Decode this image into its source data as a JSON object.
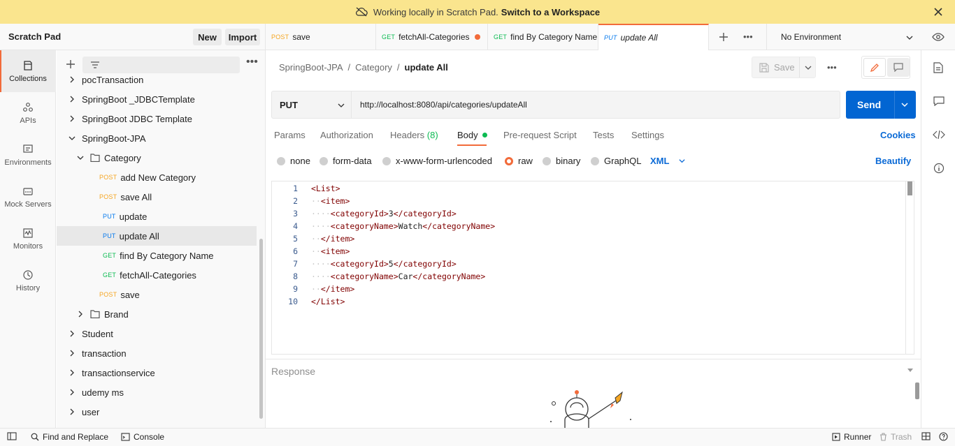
{
  "banner": {
    "text": "Working locally in Scratch Pad.",
    "link": "Switch to a Workspace"
  },
  "workspace": {
    "title": "Scratch Pad",
    "new_label": "New",
    "import_label": "Import"
  },
  "rail": {
    "items": [
      {
        "label": "Collections",
        "icon": "collections-icon"
      },
      {
        "label": "APIs",
        "icon": "apis-icon"
      },
      {
        "label": "Environments",
        "icon": "environments-icon"
      },
      {
        "label": "Mock Servers",
        "icon": "mock-servers-icon"
      },
      {
        "label": "Monitors",
        "icon": "monitors-icon"
      },
      {
        "label": "History",
        "icon": "history-icon"
      }
    ]
  },
  "tree": {
    "top_partial": "pocTransaction",
    "folders_top": [
      "SpringBoot _JDBCTemplate",
      "SpringBoot JDBC Template",
      "SpringBoot-JPA"
    ],
    "subfolder": "Category",
    "requests": [
      {
        "method": "POST",
        "name": "add New Category"
      },
      {
        "method": "POST",
        "name": "save All"
      },
      {
        "method": "PUT",
        "name": "update"
      },
      {
        "method": "PUT",
        "name": "update All"
      },
      {
        "method": "GET",
        "name": "find By Category Name"
      },
      {
        "method": "GET",
        "name": "fetchAll-Categories"
      },
      {
        "method": "POST",
        "name": "save"
      }
    ],
    "brand": "Brand",
    "folders_bottom": [
      "Student",
      "transaction",
      "transactionservice",
      "udemy ms",
      "user"
    ]
  },
  "tabs": [
    {
      "method": "POST",
      "name": "save"
    },
    {
      "method": "GET",
      "name": "fetchAll-Categories"
    },
    {
      "method": "GET",
      "name": "find By Category Name"
    },
    {
      "method": "PUT",
      "name": "update All"
    }
  ],
  "environment": "No Environment",
  "breadcrumb": {
    "collection": "SpringBoot-JPA",
    "folder": "Category",
    "request": "update All"
  },
  "save_label": "Save",
  "request": {
    "method": "PUT",
    "url": "http://localhost:8080/api/categories/updateAll",
    "send_label": "Send"
  },
  "request_tabs": {
    "params": "Params",
    "authorization": "Authorization",
    "headers": "Headers",
    "headers_count": "(8)",
    "body": "Body",
    "pre_request": "Pre-request Script",
    "tests": "Tests",
    "settings": "Settings",
    "cookies": "Cookies"
  },
  "body_types": {
    "none": "none",
    "form_data": "form-data",
    "urlencoded": "x-www-form-urlencoded",
    "raw": "raw",
    "binary": "binary",
    "graphql": "GraphQL",
    "format": "XML",
    "beautify": "Beautify"
  },
  "code": {
    "line_numbers": [
      "1",
      "2",
      "3",
      "4",
      "5",
      "6",
      "7",
      "8",
      "9",
      "10"
    ],
    "lines": [
      {
        "indent": "",
        "open": "<List>",
        "text": "",
        "close": ""
      },
      {
        "indent": "··",
        "open": "<item>",
        "text": "",
        "close": ""
      },
      {
        "indent": "····",
        "open": "<categoryId>",
        "text": "3",
        "close": "</categoryId>"
      },
      {
        "indent": "····",
        "open": "<categoryName>",
        "text": "Watch",
        "close": "</categoryName>"
      },
      {
        "indent": "··",
        "open": "</item>",
        "text": "",
        "close": ""
      },
      {
        "indent": "··",
        "open": "<item>",
        "text": "",
        "close": ""
      },
      {
        "indent": "····",
        "open": "<categoryId>",
        "text": "5",
        "close": "</categoryId>"
      },
      {
        "indent": "····",
        "open": "<categoryName>",
        "text": "Car",
        "close": "</categoryName>"
      },
      {
        "indent": "··",
        "open": "</item>",
        "text": "",
        "close": ""
      },
      {
        "indent": "",
        "open": "</List>",
        "text": "",
        "close": ""
      }
    ]
  },
  "response_label": "Response",
  "statusbar": {
    "find_replace": "Find and Replace",
    "console": "Console",
    "runner": "Runner",
    "trash": "Trash"
  },
  "colors": {
    "accent": "#f26b3a",
    "send": "#0265d2",
    "post": "#f5a623",
    "put": "#097bed",
    "get": "#0cbb52",
    "banner": "#fae58e"
  }
}
